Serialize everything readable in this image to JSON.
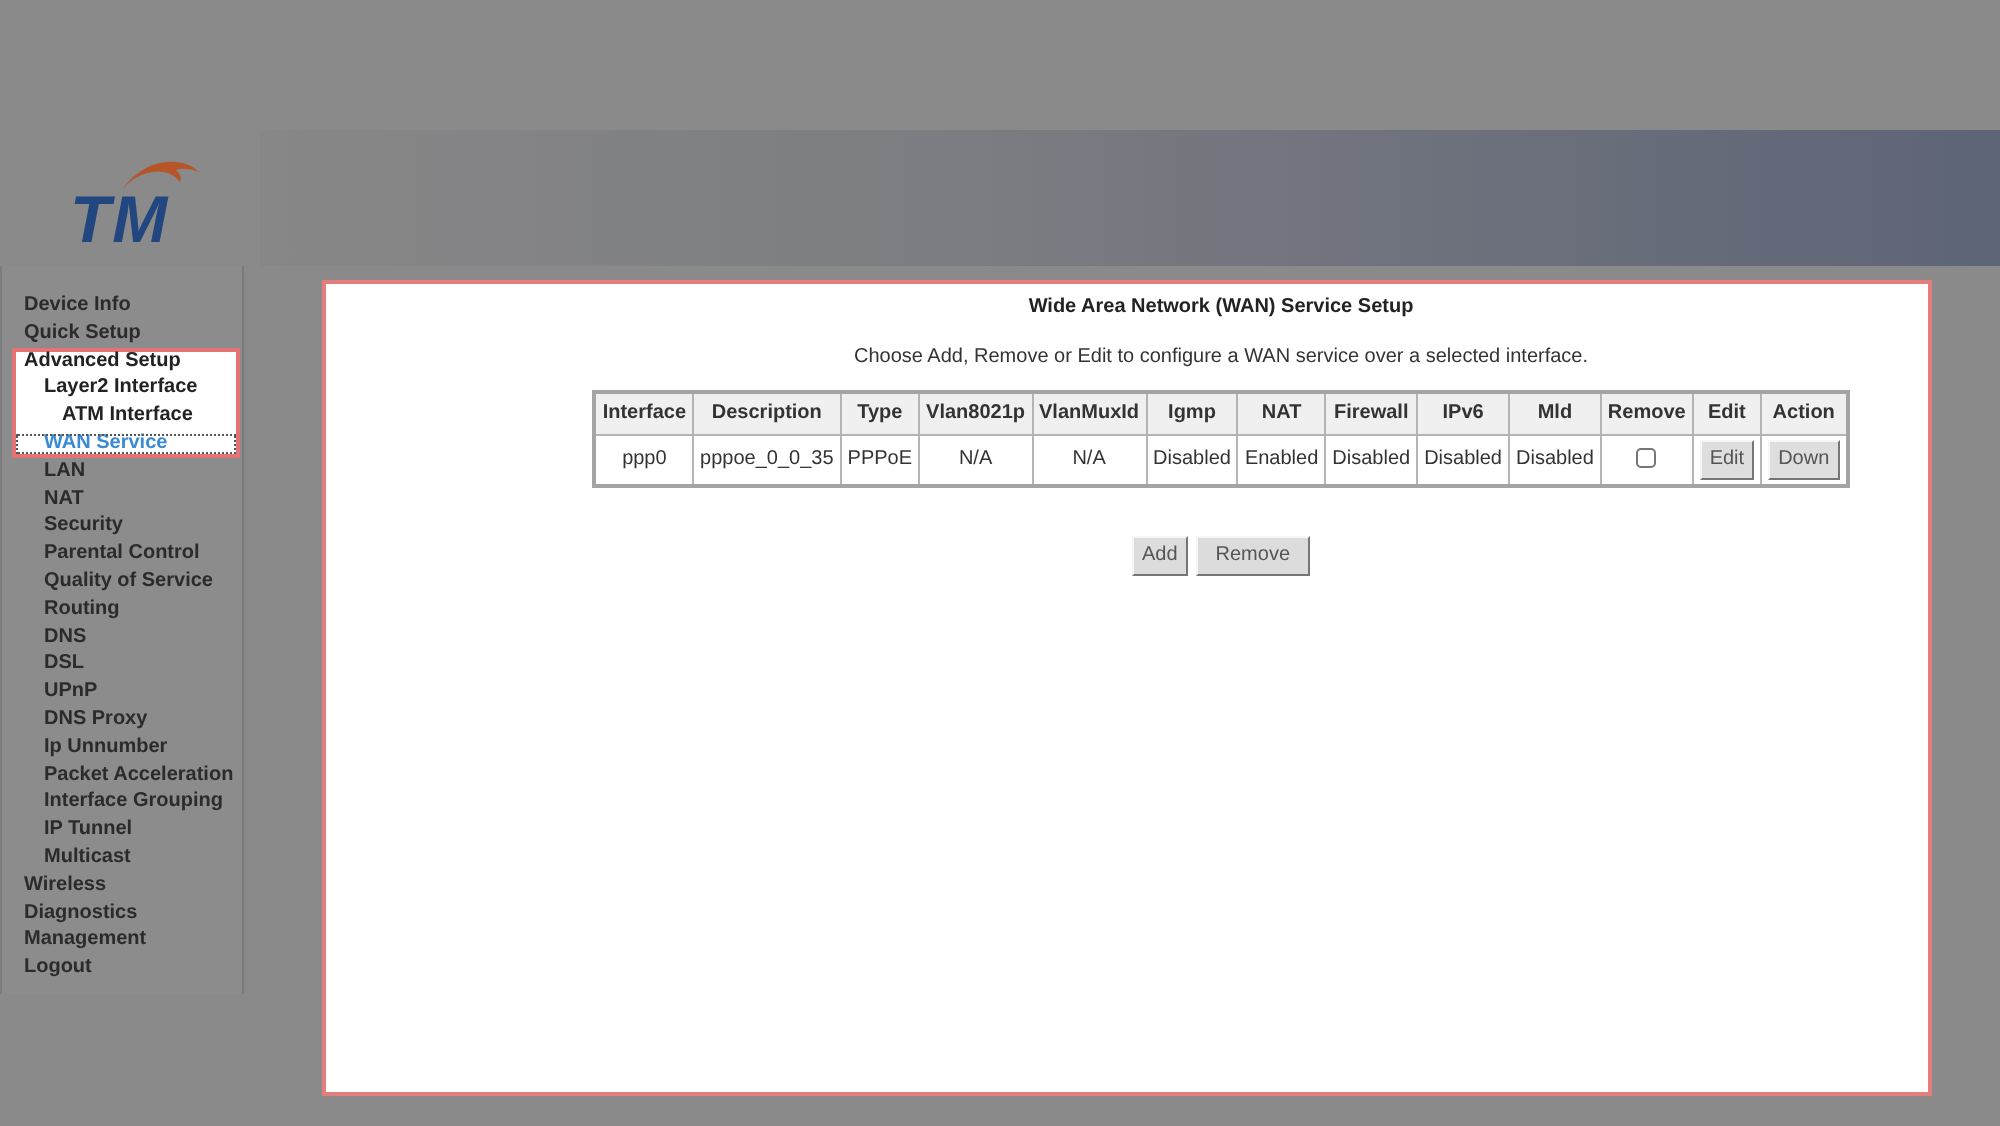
{
  "header": {
    "logo": "TM"
  },
  "sidebar": {
    "items": [
      {
        "label": "Device Info",
        "selected": false,
        "highlighted": false
      },
      {
        "label": "Quick Setup",
        "selected": false,
        "highlighted": false
      },
      {
        "label": "Advanced Setup",
        "selected": false,
        "highlighted": true,
        "children": [
          {
            "label": "Layer2 Interface",
            "selected": false,
            "highlighted": true,
            "children": [
              {
                "label": "ATM Interface",
                "selected": false,
                "highlighted": true
              }
            ]
          },
          {
            "label": "WAN Service",
            "selected": true,
            "highlighted": true
          },
          {
            "label": "LAN",
            "selected": false,
            "highlighted": false
          },
          {
            "label": "NAT",
            "selected": false,
            "highlighted": false
          },
          {
            "label": "Security",
            "selected": false,
            "highlighted": false
          },
          {
            "label": "Parental Control",
            "selected": false,
            "highlighted": false
          },
          {
            "label": "Quality of Service",
            "selected": false,
            "highlighted": false
          },
          {
            "label": "Routing",
            "selected": false,
            "highlighted": false
          },
          {
            "label": "DNS",
            "selected": false,
            "highlighted": false
          },
          {
            "label": "DSL",
            "selected": false,
            "highlighted": false
          },
          {
            "label": "UPnP",
            "selected": false,
            "highlighted": false
          },
          {
            "label": "DNS Proxy",
            "selected": false,
            "highlighted": false
          },
          {
            "label": "Ip Unnumber",
            "selected": false,
            "highlighted": false
          },
          {
            "label": "Packet Acceleration",
            "selected": false,
            "highlighted": false
          },
          {
            "label": "Interface Grouping",
            "selected": false,
            "highlighted": false
          },
          {
            "label": "IP Tunnel",
            "selected": false,
            "highlighted": false
          },
          {
            "label": "Multicast",
            "selected": false,
            "highlighted": false
          }
        ]
      },
      {
        "label": "Wireless",
        "selected": false,
        "highlighted": false
      },
      {
        "label": "Diagnostics",
        "selected": false,
        "highlighted": false
      },
      {
        "label": "Management",
        "selected": false,
        "highlighted": false
      },
      {
        "label": "Logout",
        "selected": false,
        "highlighted": false
      }
    ]
  },
  "panel": {
    "highlighted": true,
    "title": "Wide Area Network (WAN) Service Setup",
    "instruction": "Choose Add, Remove or Edit to configure a WAN service over a selected interface.",
    "table": {
      "columns": [
        "Interface",
        "Description",
        "Type",
        "Vlan8021p",
        "VlanMuxId",
        "Igmp",
        "NAT",
        "Firewall",
        "IPv6",
        "Mld",
        "Remove",
        "Edit",
        "Action"
      ],
      "rows": [
        {
          "cells": [
            {
              "kind": "text",
              "text": "ppp0"
            },
            {
              "kind": "text",
              "text": "pppoe_0_0_35"
            },
            {
              "kind": "text",
              "text": "PPPoE"
            },
            {
              "kind": "text",
              "text": "N/A"
            },
            {
              "kind": "text",
              "text": "N/A"
            },
            {
              "kind": "text",
              "text": "Disabled"
            },
            {
              "kind": "text",
              "text": "Enabled"
            },
            {
              "kind": "text",
              "text": "Disabled"
            },
            {
              "kind": "text",
              "text": "Disabled"
            },
            {
              "kind": "text",
              "text": "Disabled"
            },
            {
              "kind": "checkbox",
              "checked": false
            },
            {
              "kind": "button",
              "label": "Edit"
            },
            {
              "kind": "button",
              "label": "Down"
            }
          ]
        }
      ]
    },
    "buttons": [
      "Add",
      "Remove"
    ]
  }
}
